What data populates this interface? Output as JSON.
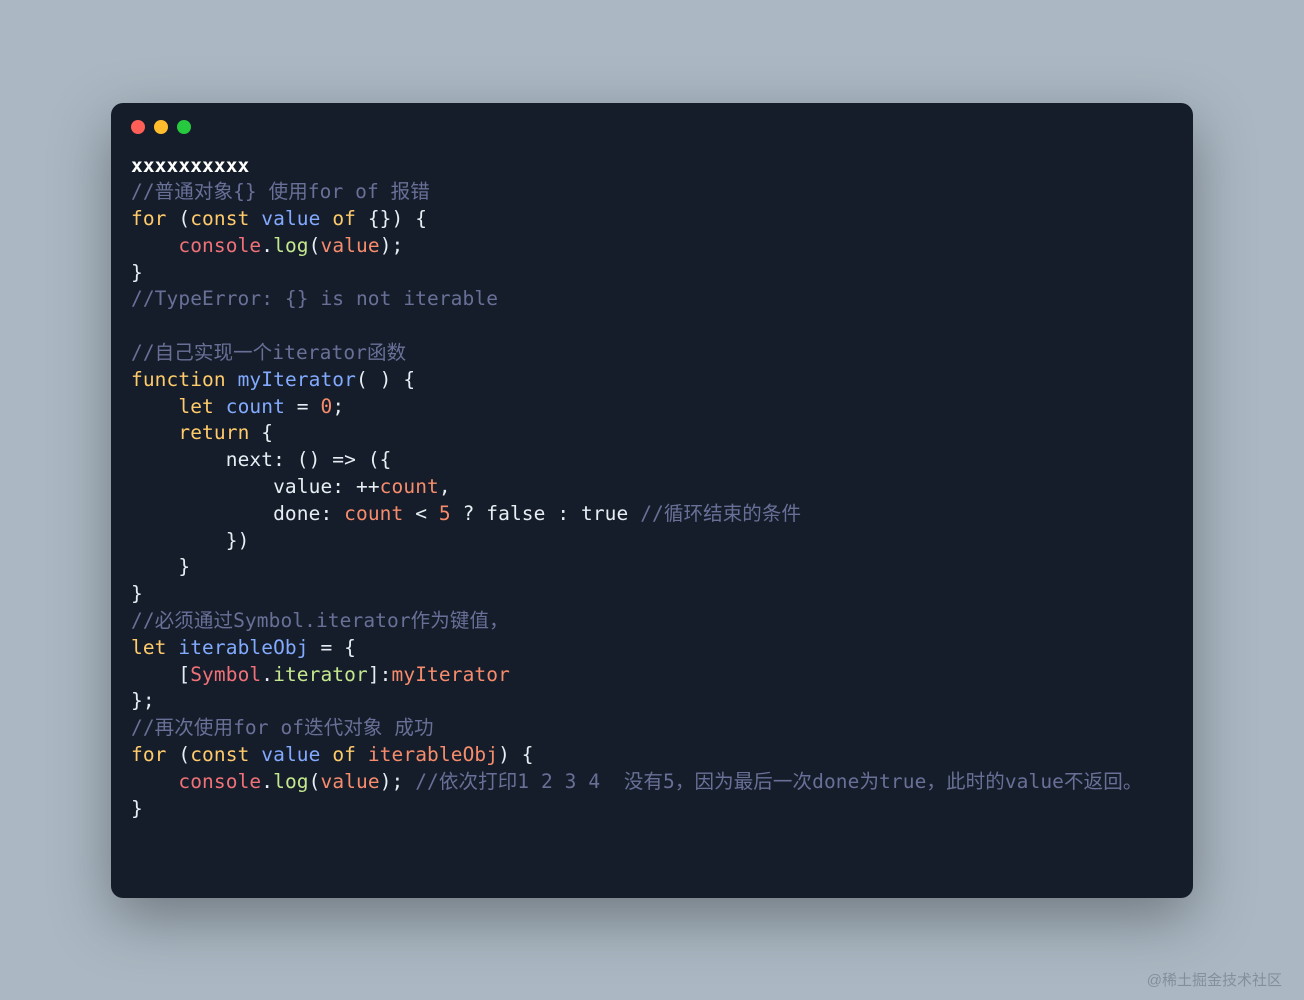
{
  "watermark": "@稀土掘金技术社区",
  "code": {
    "line1_x": "xxxxxxxxxx",
    "line2_cmt": "//普通对象{} 使用for of 报错",
    "line3": {
      "for": "for",
      "const": "const",
      "value": "value",
      "of": "of"
    },
    "line4": {
      "console": "console",
      "log": "log",
      "value": "value"
    },
    "line6_cmt": "//TypeError: {} is not iterable",
    "line8_cmt": "//自己实现一个iterator函数",
    "line9": {
      "function": "function",
      "name": "myIterator"
    },
    "line10": {
      "let": "let",
      "count": "count",
      "zero": "0"
    },
    "line11": {
      "return": "return"
    },
    "line12": {
      "next": "next"
    },
    "line13": {
      "value": "value",
      "count": "count"
    },
    "line14": {
      "done": "done",
      "count": "count",
      "five": "5",
      "false": "false",
      "true": "true",
      "cmt": "//循环结束的条件"
    },
    "line18_cmt": "//必须通过Symbol.iterator作为键值，",
    "line19": {
      "let": "let",
      "name": "iterableObj"
    },
    "line20": {
      "symbol": "Symbol",
      "iterator": "iterator",
      "myIterator": "myIterator"
    },
    "line22_cmt": "//再次使用for of迭代对象 成功",
    "line23": {
      "for": "for",
      "const": "const",
      "value": "value",
      "of": "of",
      "obj": "iterableObj"
    },
    "line24": {
      "console": "console",
      "log": "log",
      "value": "value",
      "cmt": "//依次打印1 2 3 4  没有5，因为最后一次done为true，此时的value不返回。"
    }
  }
}
